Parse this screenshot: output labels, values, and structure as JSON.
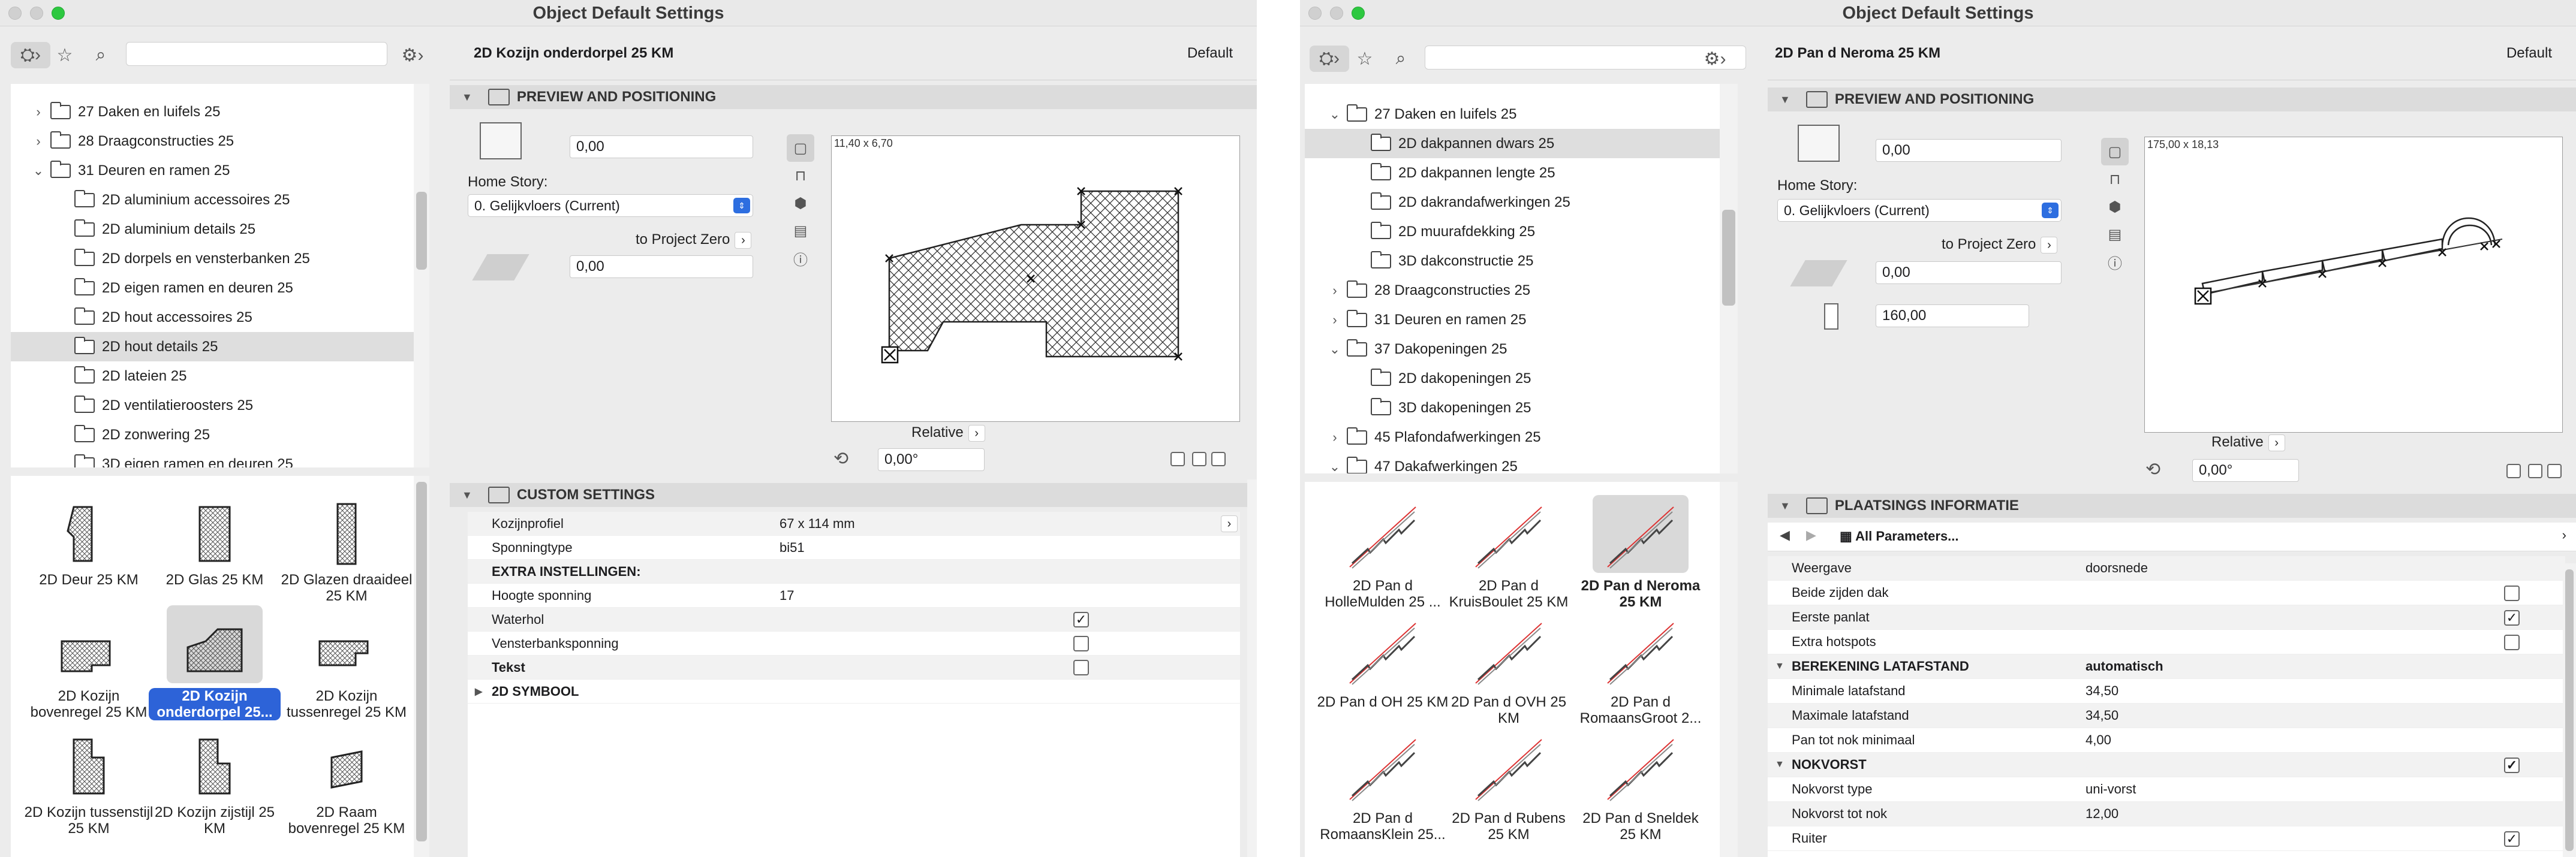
{
  "window1": {
    "title": "Object Default Settings",
    "tree": [
      {
        "label": "27 Daken en luifels 25",
        "level": 0,
        "expanded": false
      },
      {
        "label": "28 Draagconstructies 25",
        "level": 0,
        "expanded": false
      },
      {
        "label": "31 Deuren en ramen 25",
        "level": 0,
        "expanded": true
      },
      {
        "label": "2D aluminium accessoires 25",
        "level": 1
      },
      {
        "label": "2D aluminium details 25",
        "level": 1
      },
      {
        "label": "2D dorpels en vensterbanken 25",
        "level": 1
      },
      {
        "label": "2D eigen ramen en deuren 25",
        "level": 1
      },
      {
        "label": "2D hout accessoires 25",
        "level": 1
      },
      {
        "label": "2D hout details 25",
        "level": 1,
        "selected": true
      },
      {
        "label": "2D lateien 25",
        "level": 1
      },
      {
        "label": "2D ventilatieroosters 25",
        "level": 1
      },
      {
        "label": "2D zonwering 25",
        "level": 1
      },
      {
        "label": "3D eigen ramen en deuren 25",
        "level": 1
      }
    ],
    "gallery": [
      {
        "label": "2D Deur 25 KM"
      },
      {
        "label": "2D Glas 25 KM"
      },
      {
        "label": "2D Glazen draaideel 25 KM"
      },
      {
        "label": "2D Kozijn bovenregel 25 KM"
      },
      {
        "label": "2D Kozijn onderdorpel 25...",
        "selected": true
      },
      {
        "label": "2D Kozijn tussenregel 25 KM"
      },
      {
        "label": "2D Kozijn tussenstijl 25 KM"
      },
      {
        "label": "2D Kozijn zijstijl 25 KM"
      },
      {
        "label": "2D Raam bovenregel 25 KM"
      }
    ],
    "header": {
      "object_name": "2D Kozijn onderdorpel 25 KM",
      "default_label": "Default"
    },
    "preview_section": "PREVIEW AND POSITIONING",
    "offset_value": "0,00",
    "home_story_label": "Home Story:",
    "home_story_value": "0. Gelijkvloers (Current)",
    "to_project_zero": "to Project Zero",
    "elevation_value": "0,00",
    "preview_size": "11,40 x 6,70",
    "relative_label": "Relative",
    "angle_value": "0,00°",
    "custom_section": "CUSTOM SETTINGS",
    "params": [
      {
        "k": "Kozijnprofiel",
        "v": "67 x 114 mm",
        "arrow": true
      },
      {
        "k": "Sponningtype",
        "v": "bi51"
      },
      {
        "k": "EXTRA INSTELLINGEN:",
        "v": "",
        "bold": true
      },
      {
        "k": "Hoogte sponning",
        "v": "17"
      },
      {
        "k": "Waterhol",
        "check": true
      },
      {
        "k": "Vensterbanksponning",
        "check": false
      },
      {
        "k": "Tekst",
        "check": false,
        "bold": true
      }
    ],
    "symbol_section": "2D SYMBOOL"
  },
  "window2": {
    "title": "Object Default Settings",
    "tree": [
      {
        "label": "27 Daken en luifels 25",
        "level": 0,
        "expanded": true
      },
      {
        "label": "2D dakpannen dwars 25",
        "level": 1,
        "selected": true
      },
      {
        "label": "2D dakpannen lengte 25",
        "level": 1
      },
      {
        "label": "2D dakrandafwerkingen 25",
        "level": 1
      },
      {
        "label": "2D muurafdekking 25",
        "level": 1
      },
      {
        "label": "3D dakconstructie 25",
        "level": 1
      },
      {
        "label": "28 Draagconstructies 25",
        "level": 0,
        "expanded": false
      },
      {
        "label": "31 Deuren en ramen 25",
        "level": 0,
        "expanded": false
      },
      {
        "label": "37 Dakopeningen 25",
        "level": 0,
        "expanded": true
      },
      {
        "label": "2D dakopeningen 25",
        "level": 1
      },
      {
        "label": "3D dakopeningen 25",
        "level": 1
      },
      {
        "label": "45 Plafondafwerkingen 25",
        "level": 0,
        "expanded": false
      },
      {
        "label": "47 Dakafwerkingen 25",
        "level": 0,
        "expanded": true
      }
    ],
    "gallery": [
      {
        "label": "2D Pan d HolleMulden 25 ..."
      },
      {
        "label": "2D Pan d KruisBoulet 25 KM"
      },
      {
        "label": "2D Pan d Neroma 25 KM",
        "selected": true
      },
      {
        "label": "2D Pan d OH 25 KM"
      },
      {
        "label": "2D Pan d OVH 25 KM"
      },
      {
        "label": "2D Pan d RomaansGroot 2..."
      },
      {
        "label": "2D Pan d RomaansKlein 25..."
      },
      {
        "label": "2D Pan d Rubens 25 KM"
      },
      {
        "label": "2D Pan d Sneldek 25 KM"
      }
    ],
    "header": {
      "object_name": "2D Pan d Neroma 25 KM",
      "default_label": "Default"
    },
    "preview_section": "PREVIEW AND POSITIONING",
    "offset_value": "0,00",
    "home_story_label": "Home Story:",
    "home_story_value": "0. Gelijkvloers (Current)",
    "to_project_zero": "to Project Zero",
    "elevation_value": "0,00",
    "length_value": "160,00",
    "preview_size": "175,00 x 18,13",
    "relative_label": "Relative",
    "angle_value": "0,00°",
    "placement_section": "PLAATSINGS INFORMATIE",
    "all_params": "All Parameters...",
    "params": [
      {
        "k": "Weergave",
        "v": "doorsnede"
      },
      {
        "k": "Beide zijden dak",
        "check": false
      },
      {
        "k": "Eerste panlat",
        "check": true
      },
      {
        "k": "Extra hotspots",
        "check": false
      },
      {
        "k": "BEREKENING LATAFSTAND",
        "v": "automatisch",
        "bold": true,
        "group": true
      },
      {
        "k": "Minimale latafstand",
        "v": "34,50"
      },
      {
        "k": "Maximale latafstand",
        "v": "34,50"
      },
      {
        "k": "Pan tot nok minimaal",
        "v": "4,00"
      },
      {
        "k": "NOKVORST",
        "check": true,
        "bold": true,
        "group": true
      },
      {
        "k": "Nokvorst type",
        "v": "uni-vorst"
      },
      {
        "k": "Nokvorst tot nok",
        "v": "12,00"
      },
      {
        "k": "Ruiter",
        "check": true
      }
    ]
  }
}
